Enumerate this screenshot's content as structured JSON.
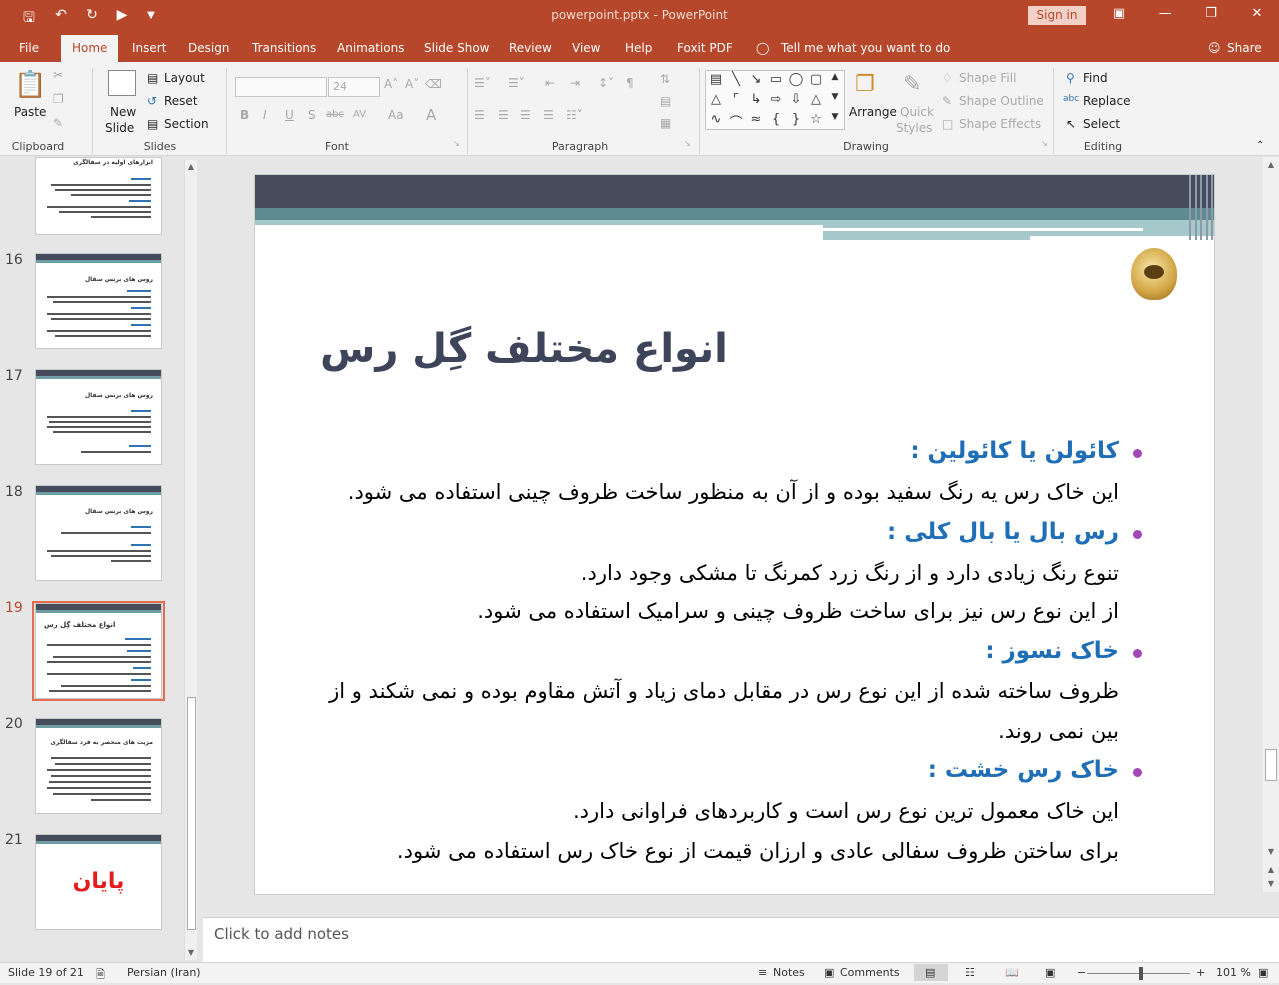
{
  "titlebar": {
    "doc_title": "powerpoint.pptx - PowerPoint",
    "signin": "Sign in",
    "save_icon": "save-icon",
    "undo_icon": "undo-icon",
    "redo_icon": "redo-icon",
    "present_icon": "present-from-beginning-icon",
    "customize_icon": "customize-toolbar-icon"
  },
  "tabs": [
    {
      "label": "File"
    },
    {
      "label": "Home"
    },
    {
      "label": "Insert"
    },
    {
      "label": "Design"
    },
    {
      "label": "Transitions"
    },
    {
      "label": "Animations"
    },
    {
      "label": "Slide Show"
    },
    {
      "label": "Review"
    },
    {
      "label": "View"
    },
    {
      "label": "Help"
    },
    {
      "label": "Foxit PDF"
    },
    {
      "label": "Tell me what you want to do"
    },
    {
      "label": "Share"
    }
  ],
  "ribbon": {
    "clipboard": {
      "paste": "Paste",
      "group": "Clipboard"
    },
    "slides": {
      "new_slide": "New",
      "new_slide2": "Slide",
      "layout": "Layout",
      "reset": "Reset",
      "section": "Section",
      "group": "Slides"
    },
    "font": {
      "size": "24",
      "bold": "B",
      "italic": "I",
      "underline": "U",
      "shadow": "S",
      "strike": "abc",
      "spacing": "AV",
      "case": "Aa",
      "color": "A",
      "group": "Font"
    },
    "paragraph": {
      "group": "Paragraph"
    },
    "drawing": {
      "arrange": "Arrange",
      "quick_styles": "Quick",
      "quick_styles2": "Styles",
      "shape_fill": "Shape Fill",
      "shape_outline": "Shape Outline",
      "shape_effects": "Shape Effects",
      "group": "Drawing"
    },
    "editing": {
      "find": "Find",
      "replace": "Replace",
      "select": "Select",
      "group": "Editing"
    }
  },
  "thumbnails": [
    {
      "num": "16",
      "title": "روس های برنس سفال"
    },
    {
      "num": "17",
      "title": "روس های برنس سفال"
    },
    {
      "num": "18",
      "title": "روس های برنس سفال"
    },
    {
      "num": "19",
      "title": "انواع مختلف گِل رس"
    },
    {
      "num": "20",
      "title": "مزیت های منحصر به فرد سفالگری"
    },
    {
      "num": "21",
      "title": "پایان"
    }
  ],
  "thumb_top": {
    "title": "ابزارهای اولیه در سفالگری"
  },
  "slide": {
    "title": "انواع مختلف گِل رس",
    "items": [
      {
        "heading": "کائولن یا کائولین :",
        "lines": [
          "این خاک رس یه رنگ سفید بوده و از آن به منظور ساخت ظروف چینی استفاده می شود."
        ]
      },
      {
        "heading": "رس بال یا بال کلی :",
        "lines": [
          "تنوع رنگ زیادی دارد و از رنگ زرد کمرنگ تا مشکی وجود دارد.",
          "از این نوع رس نیز برای ساخت ظروف چینی و سرامیک استفاده می شود."
        ]
      },
      {
        "heading": "خاک نسوز :",
        "lines": [
          "ظروف ساخته شده از این نوع رس در مقابل دمای زیاد و آتش مقاوم بوده و نمی شکند و از",
          "بین نمی روند."
        ]
      },
      {
        "heading": "خاک رس خشت :",
        "lines": [
          "این خاک معمول ترین نوع رس است و کاربردهای فراوانی دارد.",
          "برای ساختن ظروف سفالی عادی و ارزان قیمت از نوع خاک رس استفاده می شود."
        ]
      }
    ]
  },
  "notes": {
    "placeholder": "Click to add notes"
  },
  "status": {
    "slide": "Slide 19 of 21",
    "language": "Persian (Iran)",
    "notes": "Notes",
    "comments": "Comments",
    "zoom": "101 %"
  }
}
